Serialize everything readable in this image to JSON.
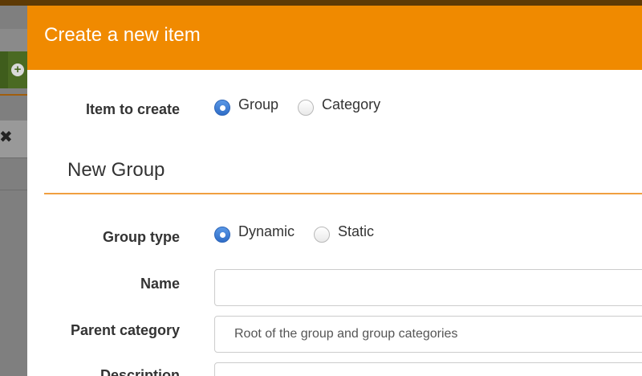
{
  "modal": {
    "title": "Create a new item"
  },
  "item_to_create": {
    "label": "Item to create",
    "options": [
      "Group",
      "Category"
    ],
    "selected": "Group"
  },
  "section": {
    "title": "New Group"
  },
  "group_type": {
    "label": "Group type",
    "options": [
      "Dynamic",
      "Static"
    ],
    "selected": "Dynamic"
  },
  "name": {
    "label": "Name",
    "value": ""
  },
  "parent_category": {
    "label": "Parent category",
    "value": "Root of the group and group categories"
  },
  "description": {
    "label": "Description"
  },
  "colors": {
    "header": "#f08a00",
    "accent_line": "#f0a040",
    "radio_checked": "#2f6dc7"
  }
}
